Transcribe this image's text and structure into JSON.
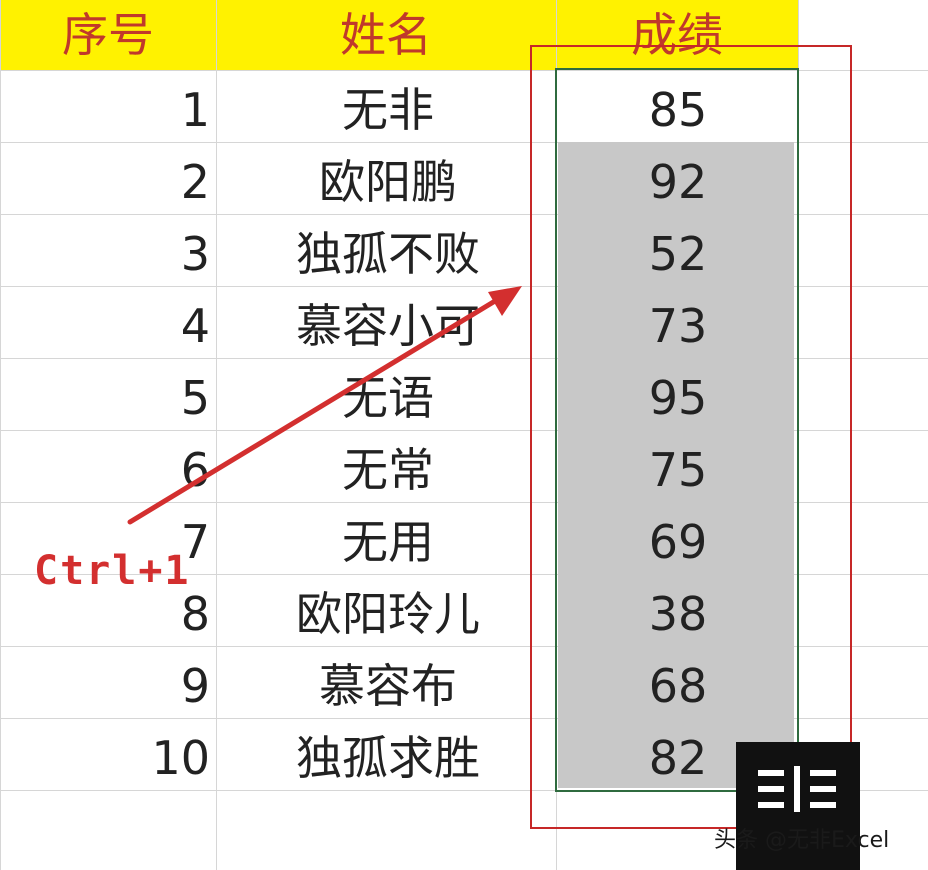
{
  "table": {
    "headers": [
      "序号",
      "姓名",
      "成绩"
    ],
    "rows": [
      {
        "no": "1",
        "name": "无非",
        "score": "85"
      },
      {
        "no": "2",
        "name": "欧阳鹏",
        "score": "92"
      },
      {
        "no": "3",
        "name": "独孤不败",
        "score": "52"
      },
      {
        "no": "4",
        "name": "慕容小可",
        "score": "73"
      },
      {
        "no": "5",
        "name": "无语",
        "score": "95"
      },
      {
        "no": "6",
        "name": "无常",
        "score": "75"
      },
      {
        "no": "7",
        "name": "无用",
        "score": "69"
      },
      {
        "no": "8",
        "name": "欧阳玲儿",
        "score": "38"
      },
      {
        "no": "9",
        "name": "慕容布",
        "score": "68"
      },
      {
        "no": "10",
        "name": "独孤求胜",
        "score": "82"
      }
    ]
  },
  "annotation": {
    "shortcut_label": "Ctrl+1"
  },
  "watermark": {
    "text": "头条 @无非Excel"
  },
  "colors": {
    "header_bg": "#fff200",
    "header_text": "#c0392b",
    "selection_fill": "#c8c8c8",
    "annotation_red": "#c62828",
    "selection_border": "#2f6b3f"
  },
  "icons": {
    "arrow": "red-arrow-icon",
    "logo": "toutiao-logo-icon"
  }
}
